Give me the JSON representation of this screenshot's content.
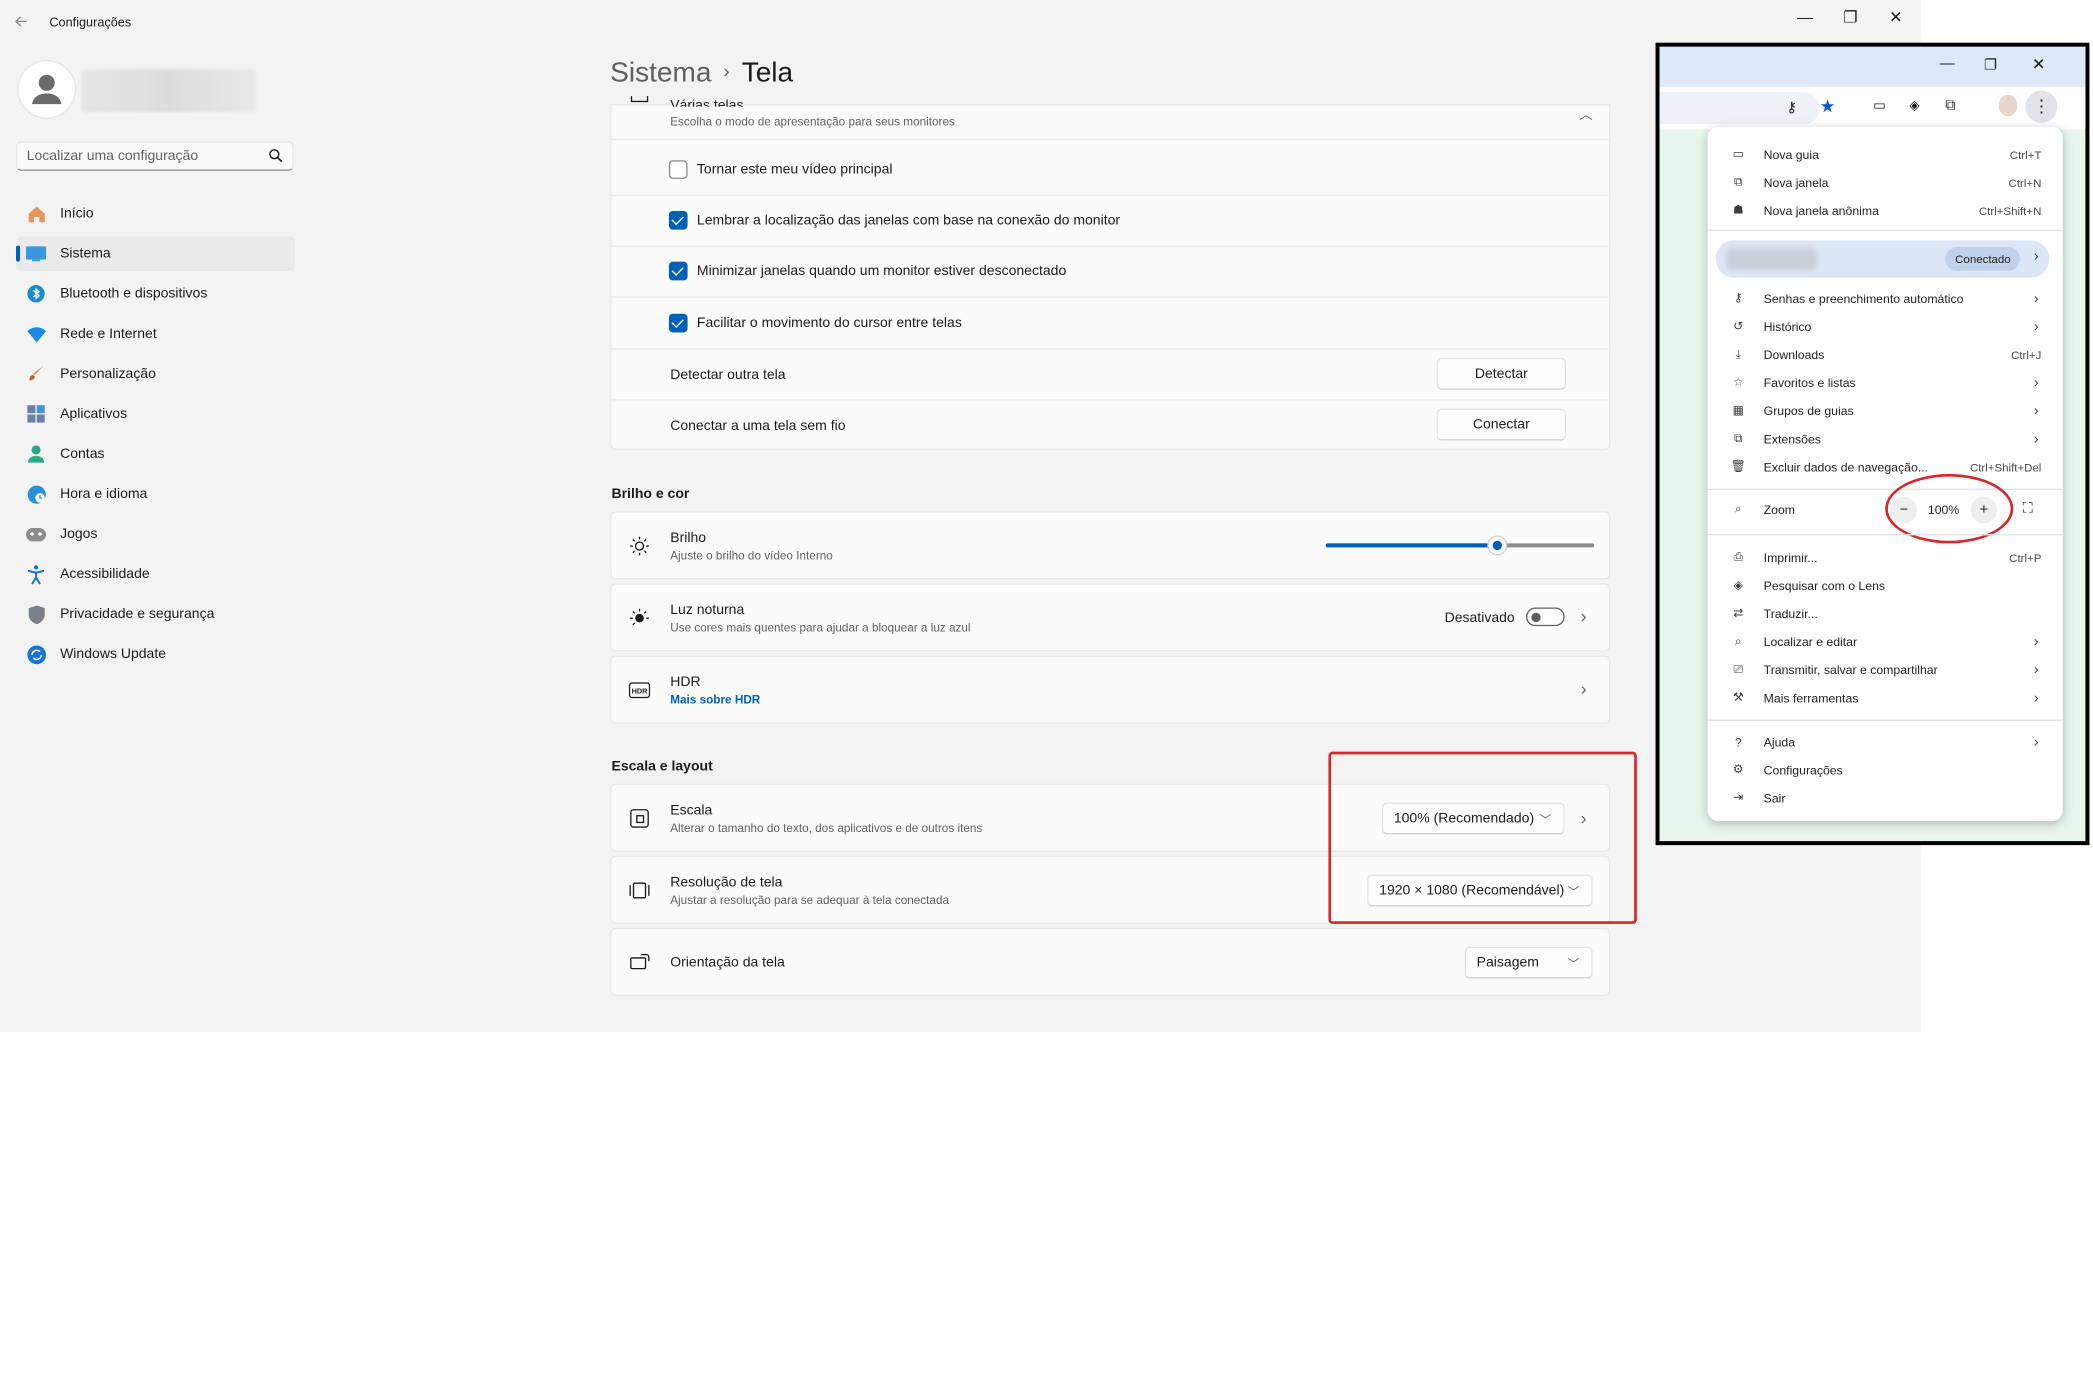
{
  "settings": {
    "app_title": "Configurações",
    "window_controls": {
      "minimize": "—",
      "maximize": "❐",
      "close": "✕"
    },
    "search_placeholder": "Localizar uma configuração",
    "nav_items": [
      {
        "label": "Início",
        "icon": "home-icon"
      },
      {
        "label": "Sistema",
        "icon": "system-icon",
        "selected": true
      },
      {
        "label": "Bluetooth e dispositivos",
        "icon": "bluetooth-icon"
      },
      {
        "label": "Rede e Internet",
        "icon": "wifi-icon"
      },
      {
        "label": "Personalização",
        "icon": "brush-icon"
      },
      {
        "label": "Aplicativos",
        "icon": "apps-icon"
      },
      {
        "label": "Contas",
        "icon": "account-icon"
      },
      {
        "label": "Hora e idioma",
        "icon": "clock-globe-icon"
      },
      {
        "label": "Jogos",
        "icon": "gamepad-icon"
      },
      {
        "label": "Acessibilidade",
        "icon": "accessibility-icon"
      },
      {
        "label": "Privacidade e segurança",
        "icon": "shield-icon"
      },
      {
        "label": "Windows Update",
        "icon": "update-icon"
      }
    ],
    "breadcrumb": {
      "parent": "Sistema",
      "separator": "›",
      "current": "Tela"
    },
    "multi_display": {
      "title": "Várias telas",
      "subtitle": "Escolha o modo de apresentação para seus monitores",
      "options": [
        {
          "label": "Tornar este meu vídeo principal",
          "checked": false
        },
        {
          "label": "Lembrar a localização das janelas com base na conexão do monitor",
          "checked": true
        },
        {
          "label": "Minimizar janelas quando um monitor estiver desconectado",
          "checked": true
        },
        {
          "label": "Facilitar o movimento do cursor entre telas",
          "checked": true
        }
      ],
      "detect_label": "Detectar outra tela",
      "detect_button": "Detectar",
      "connect_label": "Conectar a uma tela sem fio",
      "connect_button": "Conectar"
    },
    "brightness_section": {
      "heading": "Brilho e cor",
      "brightness_title": "Brilho",
      "brightness_sub": "Ajuste o brilho do vídeo Interno",
      "brightness_level": 0.64,
      "night_title": "Luz noturna",
      "night_sub": "Use cores mais quentes para ajudar a bloquear a luz azul",
      "night_state": "Desativado",
      "hdr_title": "HDR",
      "hdr_link": "Mais sobre HDR"
    },
    "scale_section": {
      "heading": "Escala e layout",
      "scale_title": "Escala",
      "scale_sub": "Alterar o tamanho do texto, dos aplicativos e de outros itens",
      "scale_value": "100% (Recomendado)",
      "resolution_title": "Resolução de tela",
      "resolution_sub": "Ajustar a resolução para se adequar à tela conectada",
      "resolution_value": "1920 × 1080 (Recomendável)",
      "orientation_title": "Orientação da tela",
      "orientation_value": "Paisagem"
    }
  },
  "browser_menu": {
    "items_top": [
      {
        "label": "Nova guia",
        "shortcut": "Ctrl+T",
        "icon": "new-tab-icon"
      },
      {
        "label": "Nova janela",
        "shortcut": "Ctrl+N",
        "icon": "new-window-icon"
      },
      {
        "label": "Nova janela anônima",
        "shortcut": "Ctrl+Shift+N",
        "icon": "incognito-icon"
      }
    ],
    "profile_status": "Conectado",
    "items_mid": [
      {
        "label": "Senhas e preenchimento automático",
        "shortcut": "",
        "icon": "key-icon",
        "submenu": true
      },
      {
        "label": "Histórico",
        "shortcut": "",
        "icon": "history-icon",
        "submenu": true
      },
      {
        "label": "Downloads",
        "shortcut": "Ctrl+J",
        "icon": "download-icon",
        "submenu": false
      },
      {
        "label": "Favoritos e listas",
        "shortcut": "",
        "icon": "star-icon",
        "submenu": true
      },
      {
        "label": "Grupos de guias",
        "shortcut": "",
        "icon": "tab-groups-icon",
        "submenu": true
      },
      {
        "label": "Extensões",
        "shortcut": "",
        "icon": "extension-icon",
        "submenu": true
      },
      {
        "label": "Excluir dados de navegação...",
        "shortcut": "Ctrl+Shift+Del",
        "icon": "trash-icon",
        "submenu": false
      }
    ],
    "zoom_label": "Zoom",
    "zoom_value": "100%",
    "items_tools": [
      {
        "label": "Imprimir...",
        "shortcut": "Ctrl+P",
        "icon": "print-icon",
        "submenu": false
      },
      {
        "label": "Pesquisar com o Lens",
        "shortcut": "",
        "icon": "lens-icon",
        "submenu": false
      },
      {
        "label": "Traduzir...",
        "shortcut": "",
        "icon": "translate-icon",
        "submenu": false
      },
      {
        "label": "Localizar e editar",
        "shortcut": "",
        "icon": "find-icon",
        "submenu": true
      },
      {
        "label": "Transmitir, salvar e compartilhar",
        "shortcut": "",
        "icon": "cast-icon",
        "submenu": true
      },
      {
        "label": "Mais ferramentas",
        "shortcut": "",
        "icon": "toolbox-icon",
        "submenu": true
      }
    ],
    "items_bottom": [
      {
        "label": "Ajuda",
        "shortcut": "",
        "icon": "help-icon",
        "submenu": true
      },
      {
        "label": "Configurações",
        "shortcut": "",
        "icon": "settings-icon",
        "submenu": false
      },
      {
        "label": "Sair",
        "shortcut": "",
        "icon": "exit-icon",
        "submenu": false
      }
    ]
  },
  "colors": {
    "accent": "#005fb8",
    "highlight": "#d9262c"
  }
}
